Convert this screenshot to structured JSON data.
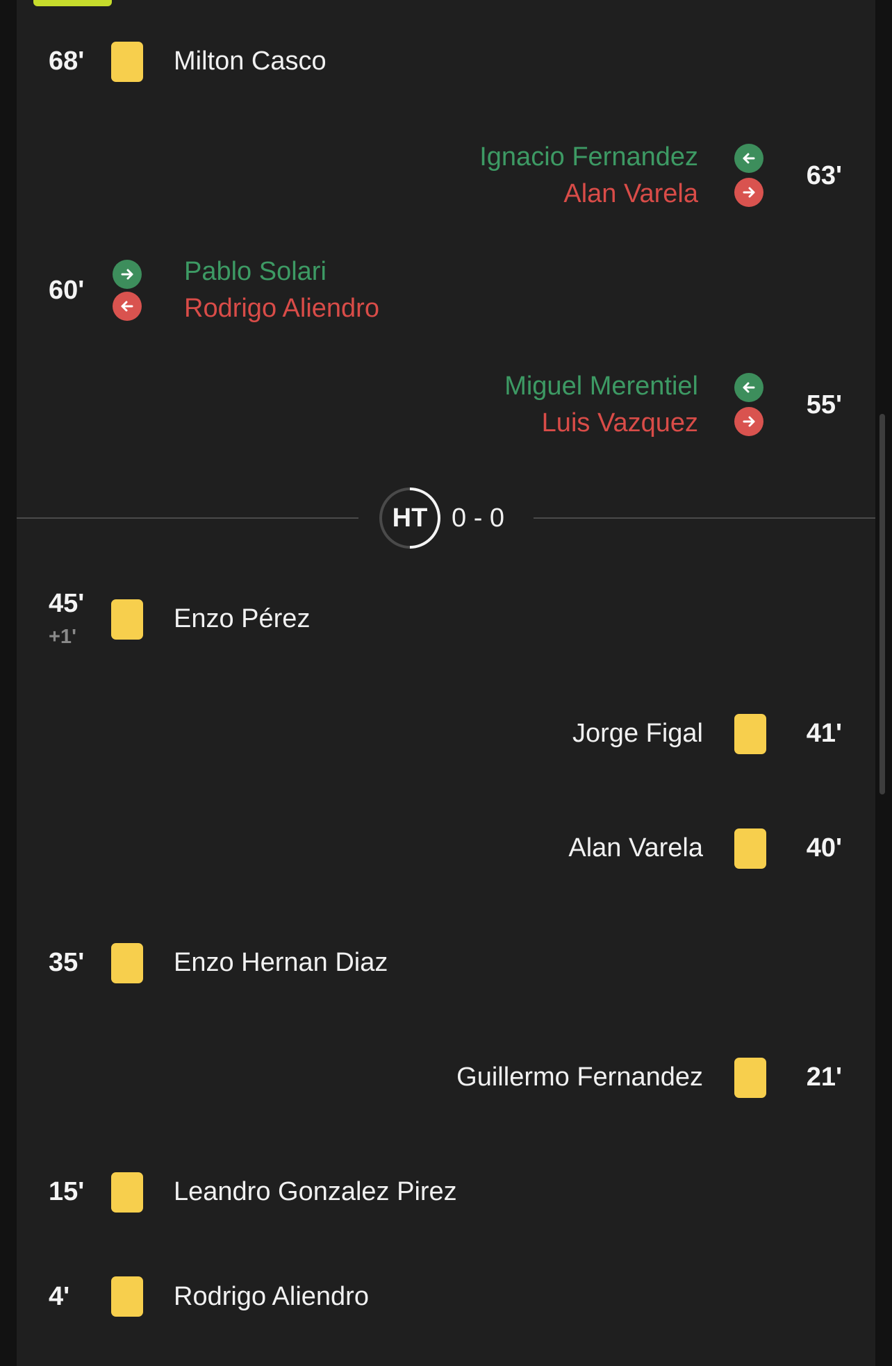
{
  "timeline": {
    "events": [
      {
        "side": "home",
        "type": "yellow_card",
        "minute": "68'",
        "player": "Milton Casco"
      },
      {
        "side": "away",
        "type": "substitution",
        "minute": "63'",
        "player_in": "Ignacio Fernandez",
        "player_out": "Alan Varela"
      },
      {
        "side": "home",
        "type": "substitution",
        "minute": "60'",
        "player_in": "Pablo Solari",
        "player_out": "Rodrigo Aliendro"
      },
      {
        "side": "away",
        "type": "substitution",
        "minute": "55'",
        "player_in": "Miguel Merentiel",
        "player_out": "Luis Vazquez"
      },
      {
        "side": "home",
        "type": "yellow_card",
        "minute": "45'",
        "extra": "+1'",
        "player": "Enzo Pérez"
      },
      {
        "side": "away",
        "type": "yellow_card",
        "minute": "41'",
        "player": "Jorge Figal"
      },
      {
        "side": "away",
        "type": "yellow_card",
        "minute": "40'",
        "player": "Alan Varela"
      },
      {
        "side": "home",
        "type": "yellow_card",
        "minute": "35'",
        "player": "Enzo Hernan Diaz"
      },
      {
        "side": "away",
        "type": "yellow_card",
        "minute": "21'",
        "player": "Guillermo Fernandez"
      },
      {
        "side": "home",
        "type": "yellow_card",
        "minute": "15'",
        "player": "Leandro Gonzalez Pirez"
      },
      {
        "side": "home",
        "type": "yellow_card",
        "minute": "4'",
        "player": "Rodrigo Aliendro"
      }
    ],
    "halftime": {
      "label": "HT",
      "score": "0 - 0"
    }
  },
  "colors": {
    "background": "#1f1f1f",
    "yellow_card": "#f7cf4d",
    "sub_in": "#3d9a64",
    "sub_out": "#d94c48",
    "accent": "#c6dc2c"
  },
  "icons": {
    "sub_in": "arrow-in-icon",
    "sub_out": "arrow-out-icon",
    "card": "yellow-card-icon"
  }
}
